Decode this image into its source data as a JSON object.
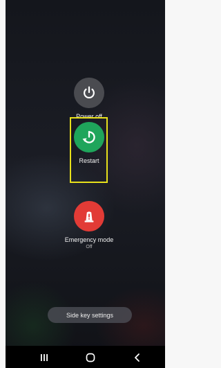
{
  "power_menu": {
    "power_off": {
      "label": "Power off",
      "icon": "power-icon"
    },
    "restart": {
      "label": "Restart",
      "icon": "restart-icon"
    },
    "emergency": {
      "label": "Emergency mode",
      "status": "Off",
      "icon": "emergency-light-icon"
    },
    "side_key_settings": {
      "label": "Side key settings"
    }
  },
  "navbar": {
    "recents_icon": "recents-icon",
    "home_icon": "home-icon",
    "back_icon": "back-icon"
  },
  "colors": {
    "power_off_bg": "#4a4b50",
    "restart_bg": "#1fa55b",
    "emergency_bg": "#e23b36",
    "highlight": "#e8e11b"
  }
}
